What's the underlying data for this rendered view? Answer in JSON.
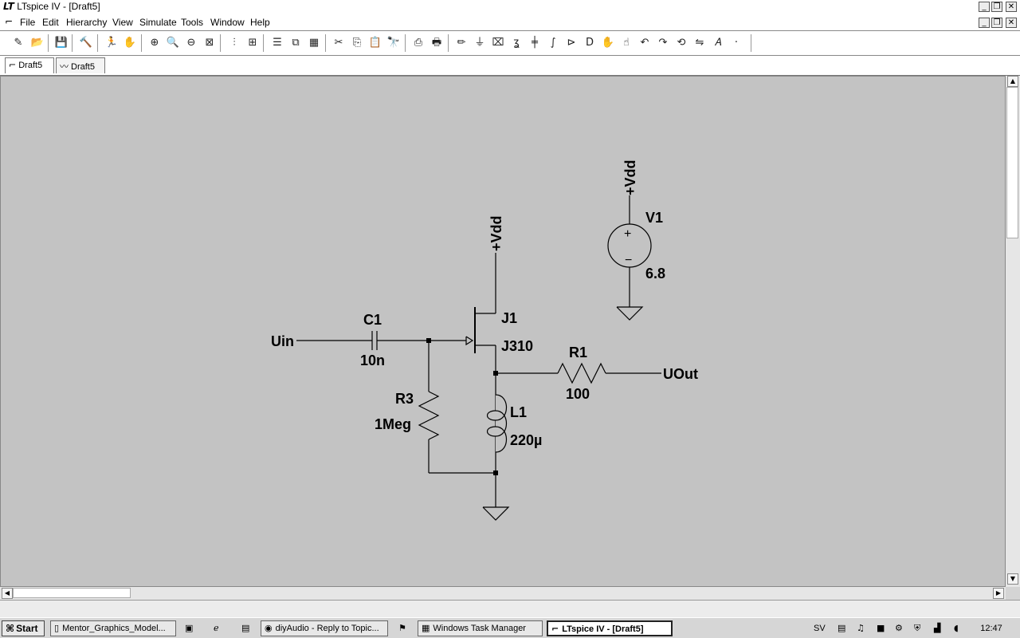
{
  "window": {
    "title": "LTspice IV - [Draft5]",
    "controls": {
      "minimize": "_",
      "restore": "❐",
      "close": "✕"
    }
  },
  "menu": {
    "items": [
      "File",
      "Edit",
      "Hierarchy",
      "View",
      "Simulate",
      "Tools",
      "Window",
      "Help"
    ]
  },
  "tabs": [
    {
      "label": "Draft5",
      "icon": "schematic-icon"
    },
    {
      "label": "Draft5",
      "icon": "waveform-icon"
    }
  ],
  "schematic": {
    "labels": {
      "uin": "Uin",
      "uout": "UOut",
      "c1_name": "C1",
      "c1_value": "10n",
      "r3_name": "R3",
      "r3_value": "1Meg",
      "j1_name": "J1",
      "j1_model": "J310",
      "r1_name": "R1",
      "r1_value": "100",
      "l1_name": "L1",
      "l1_value": "220µ",
      "v1_name": "V1",
      "v1_value": "6.8",
      "vdd_j1": "+Vdd",
      "vdd_v1": "+Vdd",
      "plus": "+",
      "minus": "−"
    }
  },
  "taskbar": {
    "start": "Start",
    "tasks": [
      {
        "label": "Mentor_Graphics_Model...",
        "icon": "document-icon",
        "active": false
      },
      {
        "label": "diyAudio - Reply to Topic...",
        "icon": "browser-icon",
        "active": false
      },
      {
        "label": "Windows Task Manager",
        "icon": "taskmanager-icon",
        "active": false
      },
      {
        "label": "LTspice IV - [Draft5]",
        "icon": "ltspice-icon",
        "active": true
      }
    ],
    "language": "SV",
    "clock": "12:47"
  },
  "colors": {
    "canvas": "#c3c3c3",
    "wire": "#000000",
    "chrome": "#ffffff"
  }
}
